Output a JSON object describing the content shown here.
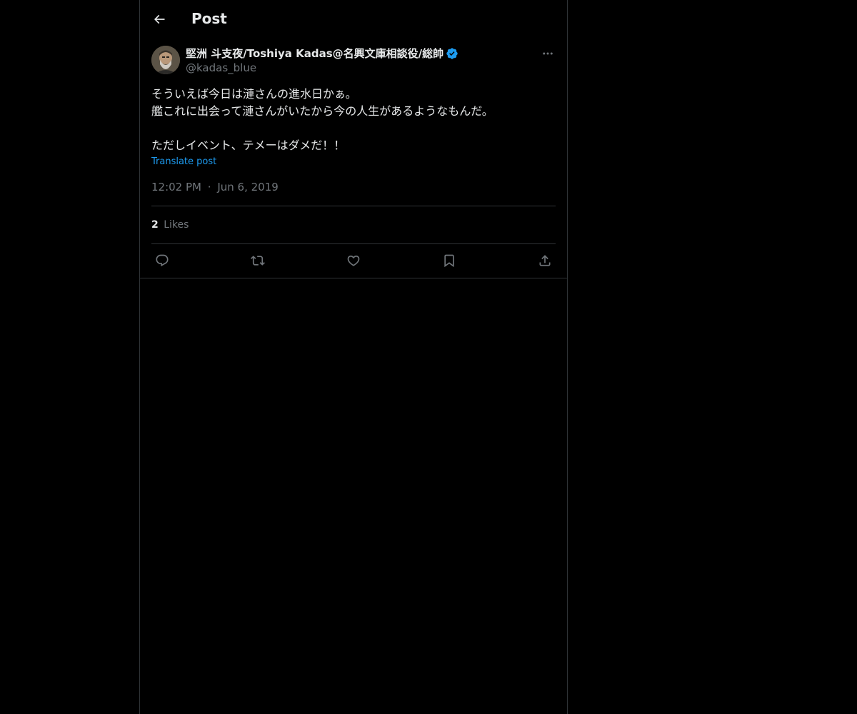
{
  "header": {
    "back_icon": "arrow-left-icon",
    "title": "Post"
  },
  "tweet": {
    "author": {
      "name": "堅洲 斗支夜/Toshiya Kadas@名興文庫相談役/総帥",
      "handle": "@kadas_blue",
      "verified": true,
      "verified_color": "#1d9bf0"
    },
    "text_lines": [
      "そういえば今日は漣さんの進水日かぁ。",
      "艦これに出会って漣さんがいたから今の人生があるようなもんだ。",
      "",
      "ただしイベント、テメーはダメだ！！"
    ],
    "translate_label": "Translate post",
    "time": "12:02 PM",
    "separator": "·",
    "date": "Jun 6, 2019",
    "likes_count": "2",
    "likes_label": "Likes",
    "actions": [
      "reply-icon",
      "repost-icon",
      "like-icon",
      "bookmark-icon",
      "share-icon"
    ]
  },
  "colors": {
    "background": "#000000",
    "text": "#e7e9ea",
    "secondary": "#71767b",
    "accent": "#1d9bf0",
    "border": "#2f3336"
  }
}
